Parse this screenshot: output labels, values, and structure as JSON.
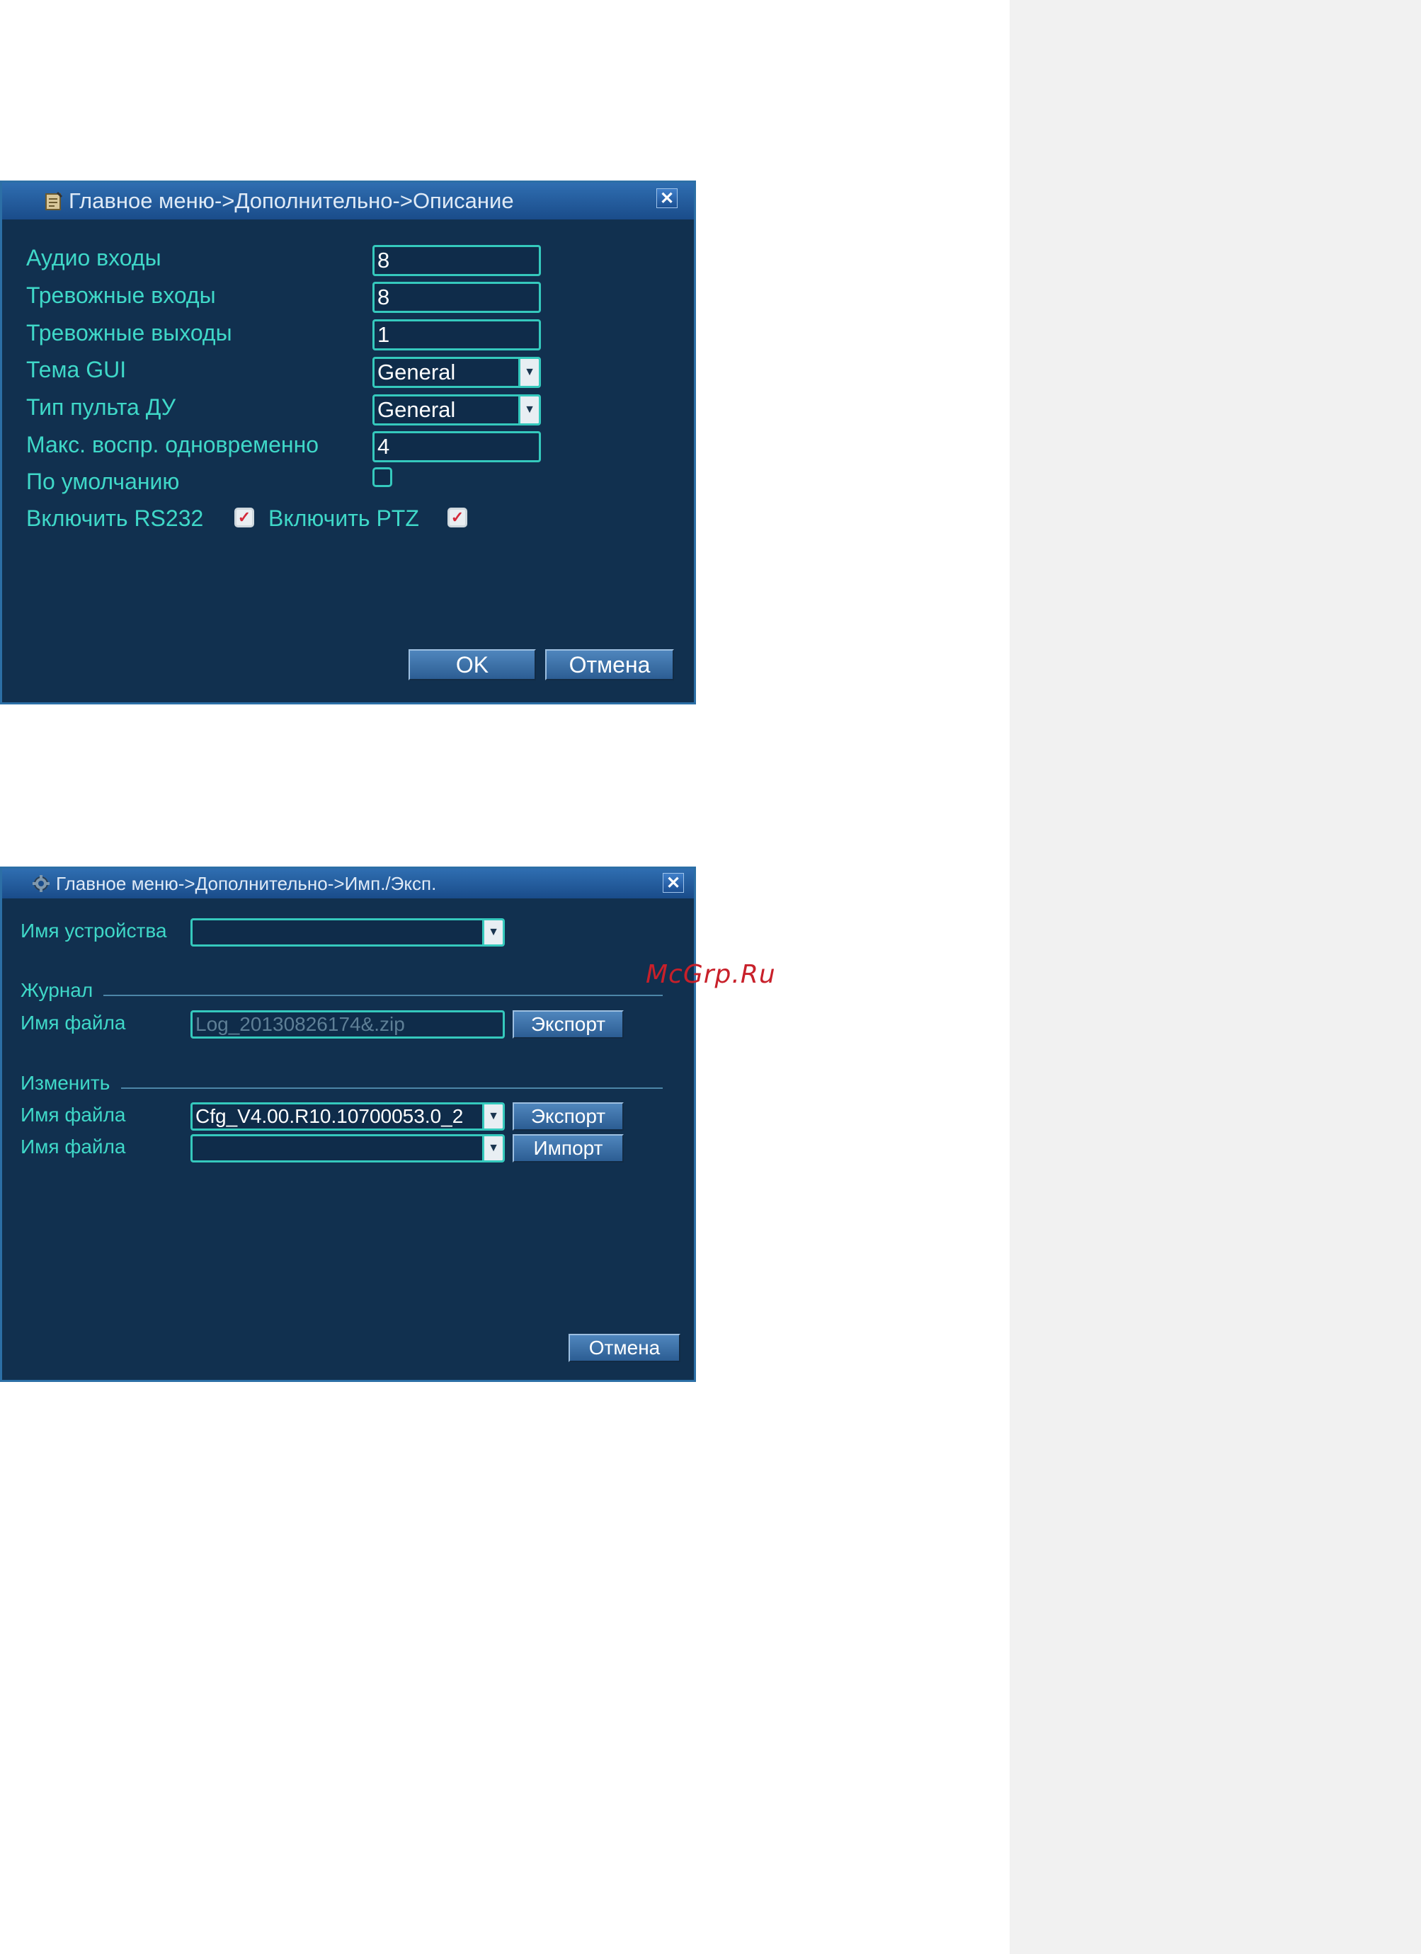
{
  "watermark": "McGrp.Ru",
  "dialog1": {
    "title": "Главное меню->Дополнительно->Описание",
    "close_label": "✕",
    "audio_inputs": {
      "label": "Аудио входы",
      "value": "8"
    },
    "alarm_inputs": {
      "label": "Тревожные входы",
      "value": "8"
    },
    "alarm_outputs": {
      "label": "Тревожные выходы",
      "value": "1"
    },
    "gui_theme": {
      "label": "Тема GUI",
      "value": "General"
    },
    "remote_type": {
      "label": "Тип пульта ДУ",
      "value": "General"
    },
    "max_playback": {
      "label": "Макс. воспр. одновременно",
      "value": "4"
    },
    "default": {
      "label": "По умолчанию",
      "checked": false
    },
    "rs232": {
      "label": "Включить RS232",
      "checked": true
    },
    "ptz": {
      "label": "Включить PTZ",
      "checked": true
    },
    "ok_label": "OK",
    "cancel_label": "Отмена"
  },
  "dialog2": {
    "title": "Главное меню->Дополнительно->Имп./Эксп.",
    "close_label": "✕",
    "device_name": {
      "label": "Имя устройства",
      "value": ""
    },
    "journal": {
      "section_label": "Журнал",
      "file_label": "Имя файла",
      "file_value": "Log_20130826174&.zip",
      "export_label": "Экспорт"
    },
    "change": {
      "section_label": "Изменить",
      "file_label_1": "Имя файла",
      "file_value_1": "Cfg_V4.00.R10.10700053.0_2",
      "export_label": "Экспорт",
      "file_label_2": "Имя файла",
      "file_value_2": "",
      "import_label": "Импорт"
    },
    "cancel_label": "Отмена"
  }
}
